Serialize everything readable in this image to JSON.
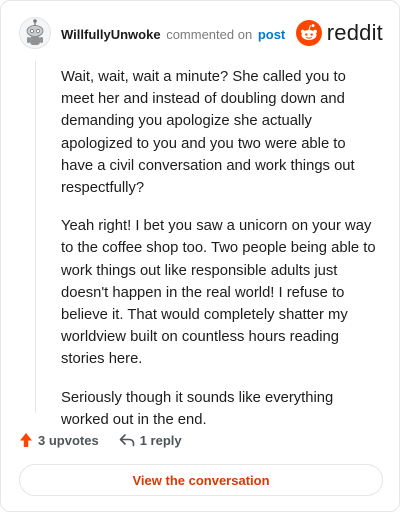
{
  "comment": {
    "username": "WillfullyUnwoke",
    "action_text": "commented on",
    "post_link": "post",
    "paragraphs": [
      "Wait, wait, wait a minute? She called you to meet her and instead of doubling down and demanding you apologize she actually apologized to you and you two were able to have a civil conversation and work things out respectfully?",
      "Yeah right! I bet you saw a unicorn on your way to the coffee shop too. Two people being able to work things out like responsible adults just doesn't happen in the real world! I refuse to believe it. That would completely shatter my worldview built on countless hours reading stories here.",
      "Seriously though it sounds like everything worked out in the end."
    ],
    "upvotes": "3 upvotes",
    "replies": "1 reply",
    "view_button": "View the conversation"
  },
  "brand": {
    "name": "reddit"
  },
  "colors": {
    "brand_orange": "#ff4500",
    "link_blue": "#0079d3",
    "button_text": "#d93a00"
  },
  "icons": {
    "avatar": "snoo-avatar-icon",
    "logo": "reddit-snoo-logo-icon",
    "upvote": "upvote-arrow-icon",
    "reply": "reply-arrow-icon"
  }
}
